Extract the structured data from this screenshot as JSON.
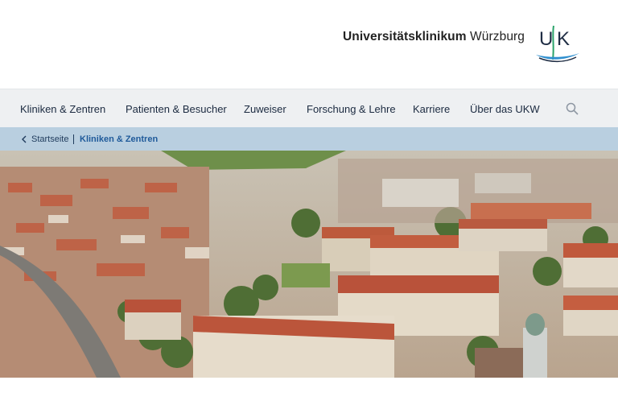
{
  "header": {
    "brand_bold": "Universitätsklinikum",
    "brand_rest": "Würzburg",
    "logo_icon": "ukw-logo-icon",
    "logo_colors": {
      "text": "#1f2d44",
      "accent": "#2f8fcf",
      "green": "#2aa36a"
    }
  },
  "nav": {
    "items": [
      {
        "label": "Kliniken & Zentren"
      },
      {
        "label": "Patienten & Besucher"
      },
      {
        "label": "Zuweiser"
      },
      {
        "label": "Forschung & Lehre"
      },
      {
        "label": "Karriere"
      },
      {
        "label": "Über das UKW"
      }
    ],
    "search_icon": "search-icon"
  },
  "breadcrumb": {
    "back_icon": "chevron-left-icon",
    "home": "Startseite",
    "current": "Kliniken & Zentren"
  },
  "colors": {
    "nav_bg": "#eef0f2",
    "breadcrumb_bg": "#b9cfe0",
    "link": "#1f5a9a",
    "roof": "#b8533a"
  }
}
